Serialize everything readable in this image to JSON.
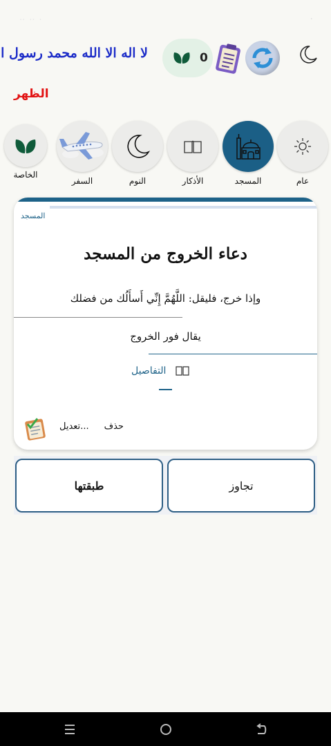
{
  "status_bar": {
    "left_items": [
      "..",
      "..",
      "."
    ],
    "time": "."
  },
  "header": {
    "tahlil": "لا اله الا الله محمد رسول الله",
    "prayer_name": "الظهر",
    "counter_value": "0"
  },
  "categories": [
    {
      "label": "عام",
      "icon": "sun-icon"
    },
    {
      "label": "المسجد",
      "icon": "mosque-icon",
      "selected": true
    },
    {
      "label": "الأذكار",
      "icon": "book-icon"
    },
    {
      "label": "النوم",
      "icon": "moon-icon"
    },
    {
      "label": "السفر",
      "icon": "airplane-icon"
    },
    {
      "label": "الخاصة",
      "icon": "leaf-icon"
    }
  ],
  "card": {
    "category": "المسجد",
    "title": "دعاء الخروج من المسجد",
    "text": "وإذا خرج، فليقل: اللَّهُمَّ إِنِّي أَسأَلُك من فضلك",
    "note": "يقال فور الخروج",
    "details_label": "التفاصيل",
    "edit_label": "تعديل...",
    "delete_label": "حذف"
  },
  "buttons": {
    "applied": "طبقتها",
    "skip": "تجاوز"
  },
  "colors": {
    "accent": "#1d6288",
    "tahlil": "#1c2cc8",
    "prayer": "#e21313",
    "counter_bg": "#e3f1e6"
  }
}
